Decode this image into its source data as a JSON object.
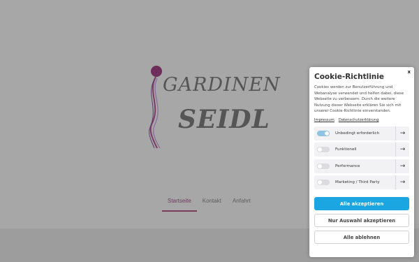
{
  "logo": {
    "line1": "GARDINEN",
    "line2": "SEIDL"
  },
  "nav": {
    "items": [
      {
        "label": "Startseite",
        "active": true
      },
      {
        "label": "Kontakt",
        "active": false
      },
      {
        "label": "Anfahrt",
        "active": false
      }
    ]
  },
  "cookie": {
    "title": "Cookie-Richtlinie",
    "close_label": "x",
    "text": "Cookies werden zur Benutzerführung und Webanalyse verwendet und helfen dabei, diese Webseite zu verbessern. Durch die weitere Nutzung dieser Webseite erklären Sie sich mit unserer Cookie-Richtlinie einverstanden.",
    "links": [
      "Impressum",
      "Datenschutzerklärung"
    ],
    "categories": [
      {
        "label": "Unbedingt erforderlich",
        "enabled": true
      },
      {
        "label": "Funktionell",
        "enabled": false
      },
      {
        "label": "Performance",
        "enabled": false
      },
      {
        "label": "Marketing / Third Party",
        "enabled": false
      }
    ],
    "buttons": {
      "accept_all": "Alle akzeptieren",
      "accept_selection": "Nur Auswahl akzeptieren",
      "reject_all": "Alle ablehnen"
    }
  },
  "colors": {
    "accent": "#1ba5e1",
    "brand": "#7a3b5e"
  }
}
